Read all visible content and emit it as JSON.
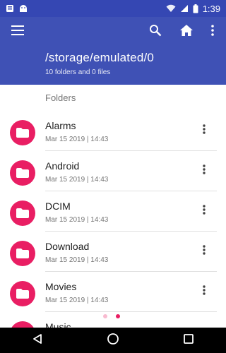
{
  "status_bar": {
    "time": "1:39",
    "icons": [
      "notification-icon",
      "android-icon",
      "wifi-icon",
      "signal-icon",
      "battery-icon"
    ]
  },
  "app_bar": {
    "path": "/storage/emulated/0",
    "summary": "10 folders and 0 files",
    "color": "#3f51b5",
    "icons": [
      "menu-icon",
      "search-icon",
      "home-icon",
      "more-vert-icon"
    ]
  },
  "section": {
    "header": "Folders"
  },
  "folders": [
    {
      "name": "Alarms",
      "date": "Mar 15 2019 | 14:43"
    },
    {
      "name": "Android",
      "date": "Mar 15 2019 | 14:43"
    },
    {
      "name": "DCIM",
      "date": "Mar 15 2019 | 14:43"
    },
    {
      "name": "Download",
      "date": "Mar 15 2019 | 14:43"
    },
    {
      "name": "Movies",
      "date": "Mar 15 2019 | 14:43"
    },
    {
      "name": "Music",
      "date": ""
    }
  ],
  "accent_color": "#e91e63",
  "nav_bar": {
    "icons": [
      "back-icon",
      "home-circle-icon",
      "recents-icon"
    ]
  }
}
